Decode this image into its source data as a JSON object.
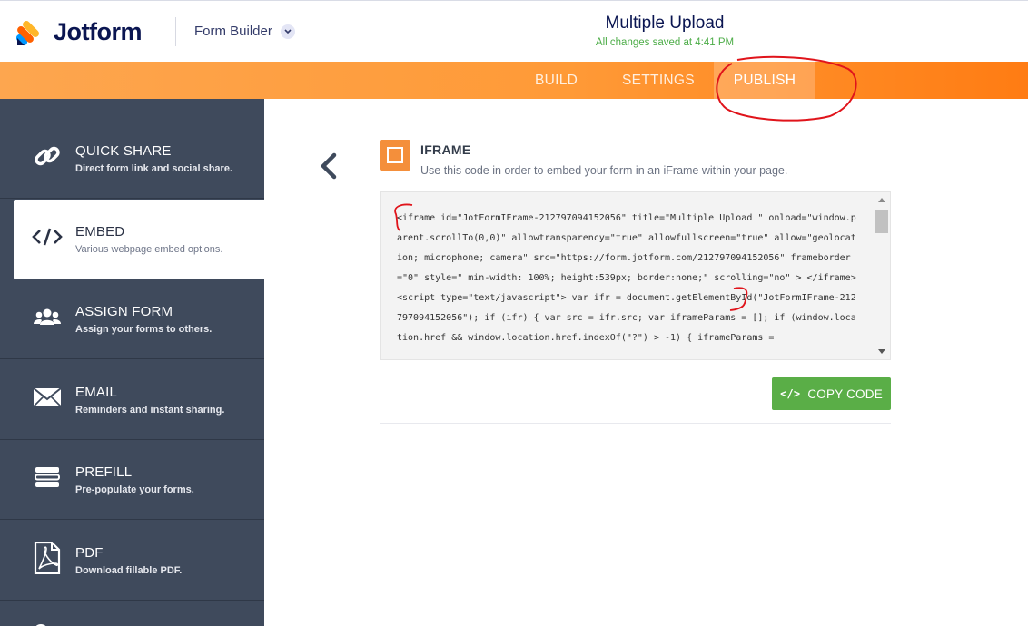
{
  "app": {
    "brand": "Jotform",
    "builder_label": "Form Builder"
  },
  "form": {
    "title": "Multiple Upload",
    "saved_status": "All changes saved at 4:41 PM"
  },
  "tabs": [
    {
      "label": "BUILD"
    },
    {
      "label": "SETTINGS"
    },
    {
      "label": "PUBLISH"
    }
  ],
  "sidebar": {
    "items": [
      {
        "label": "QUICK SHARE",
        "sub": "Direct form link and social share."
      },
      {
        "label": "EMBED",
        "sub": "Various webpage embed options."
      },
      {
        "label": "ASSIGN FORM",
        "sub": "Assign your forms to others."
      },
      {
        "label": "EMAIL",
        "sub": "Reminders and instant sharing."
      },
      {
        "label": "PREFILL",
        "sub": "Pre-populate your forms."
      },
      {
        "label": "PDF",
        "sub": "Download fillable PDF."
      }
    ]
  },
  "section": {
    "title": "IFRAME",
    "description": "Use this code in order to embed your form in an iFrame within your page."
  },
  "code": "<iframe id=\"JotFormIFrame-212797094152056\" title=\"Multiple Upload \" onload=\"window.parent.scrollTo(0,0)\" allowtransparency=\"true\" allowfullscreen=\"true\" allow=\"geolocation; microphone; camera\" src=\"https://form.jotform.com/212797094152056\" frameborder=\"0\" style=\" min-width: 100%; height:539px; border:none;\" scrolling=\"no\" > </iframe> <script type=\"text/javascript\"> var ifr = document.getElementById(\"JotFormIFrame-212797094152056\"); if (ifr) { var src = ifr.src; var iframeParams = []; if (window.location.href && window.location.href.indexOf(\"?\") > -1) { iframeParams = ",
  "copy_button": {
    "label": "COPY CODE"
  },
  "colors": {
    "accent_orange": "#ff9a37",
    "sidebar_bg": "#3f4a5c",
    "copy_green": "#5aae47",
    "annotation_red": "#e0141b"
  }
}
